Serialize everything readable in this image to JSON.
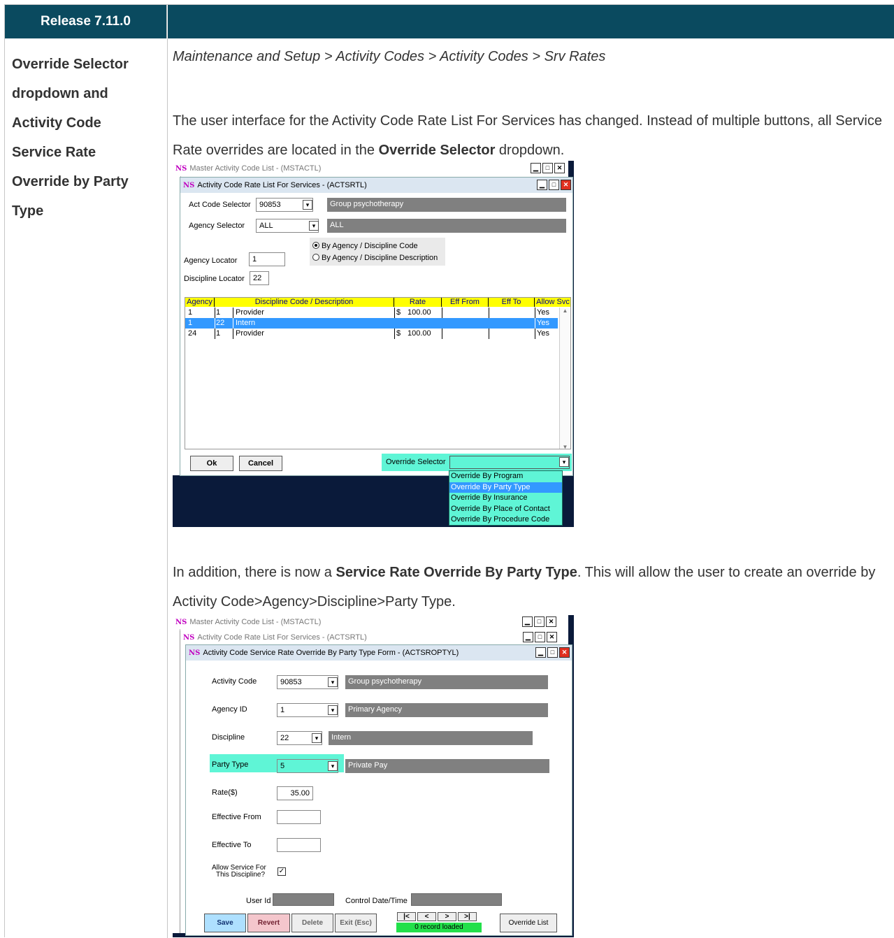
{
  "header": {
    "release": "Release 7.11.0"
  },
  "left": {
    "lines": [
      "Override Selector",
      "dropdown and",
      "Activity Code",
      "Service Rate",
      "Override by Party",
      "Type"
    ]
  },
  "breadcrumb": "Maintenance and Setup > Activity Codes > Activity Codes > Srv Rates",
  "para1": {
    "pre": "The user interface for the Activity Code Rate List For Services has changed. Instead of multiple buttons, all Service Rate overrides are located in the ",
    "bold": "Override Selector",
    "post": " dropdown."
  },
  "para2": {
    "pre": "In addition, there is now a ",
    "bold": "Service Rate Override By Party Type",
    "post": ". This will allow the user to create an override by Activity Code>Agency>Discipline>Party Type."
  },
  "shot1": {
    "master_title": "Master Activity Code List - (MSTACTL)",
    "title": "Activity Code Rate List For Services - (ACTSRTL)",
    "ns": "NS",
    "act_code_label": "Act Code Selector",
    "act_code_value": "90853",
    "act_code_desc": "Group psychotherapy",
    "agency_label": "Agency Selector",
    "agency_value": "ALL",
    "agency_desc": "ALL",
    "radio1": "By Agency / Discipline Code",
    "radio2": "By Agency / Discipline Description",
    "agency_locator_label": "Agency Locator",
    "agency_locator_value": "1",
    "discipline_locator_label": "Discipline Locator",
    "discipline_locator_value": "22",
    "grid_headers": [
      "Agency",
      "Discipline Code / Description",
      "Rate",
      "Eff From",
      "Eff To",
      "Allow Svc"
    ],
    "rows": [
      {
        "agency": "1",
        "code": "1",
        "desc": "Provider",
        "cur": "$",
        "rate": "100.00",
        "allow": "Yes"
      },
      {
        "agency": "1",
        "code": "22",
        "desc": "Intern",
        "cur": "",
        "rate": "",
        "allow": "Yes"
      },
      {
        "agency": "24",
        "code": "1",
        "desc": "Provider",
        "cur": "$",
        "rate": "100.00",
        "allow": "Yes"
      }
    ],
    "ok": "Ok",
    "cancel": "Cancel",
    "override_label": "Override Selector",
    "options": [
      "Override By Program",
      "Override By Party Type",
      "Override By Insurance",
      "Override By Place of Contact",
      "Override By Procedure Code"
    ]
  },
  "shot2": {
    "master_title": "Master Activity Code List - (MSTACTL)",
    "mid_title": "Activity Code Rate List For Services - (ACTSRTL)",
    "title": "Activity Code Service Rate Override By Party Type Form - (ACTSROPTYL)",
    "activity_code_label": "Activity Code",
    "activity_code_value": "90853",
    "activity_code_desc": "Group psychotherapy",
    "agency_label": "Agency ID",
    "agency_value": "1",
    "agency_desc": "Primary Agency",
    "discipline_label": "Discipline",
    "discipline_value": "22",
    "discipline_desc": "Intern",
    "party_label": "Party Type",
    "party_value": "5",
    "party_desc": "Private Pay",
    "rate_label": "Rate($)",
    "rate_value": "35.00",
    "eff_from_label": "Effective From",
    "eff_to_label": "Effective To",
    "allow_label_1": "Allow Service For",
    "allow_label_2": "This Discipline?",
    "user_id_label": "User Id",
    "control_label": "Control Date/Time",
    "save": "Save",
    "revert": "Revert",
    "delete": "Delete",
    "exit": "Exit (Esc)",
    "nav_first": "|<",
    "nav_prev": "<",
    "nav_next": ">",
    "nav_last": ">|",
    "record_status": "0 record loaded",
    "override_list": "Override List"
  }
}
